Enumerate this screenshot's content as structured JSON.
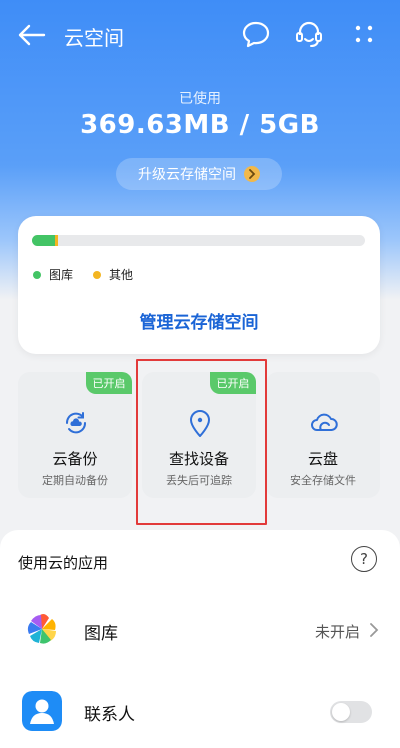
{
  "header": {
    "title": "云空间",
    "back_icon": "back-arrow-icon",
    "message_icon": "message-bubble-icon",
    "support_icon": "customer-service-icon",
    "more_icon": "more-dots-icon"
  },
  "usage": {
    "label": "已使用",
    "value": "369.63MB / 5GB",
    "upgrade_label": "升级云存储空间"
  },
  "storage": {
    "gallery_fraction": 0.07,
    "other_fraction": 0.008,
    "legend": [
      {
        "label": "图库",
        "color": "#43c465"
      },
      {
        "label": "其他",
        "color": "#f3b521"
      }
    ],
    "manage_label": "管理云存储空间"
  },
  "features": [
    {
      "name": "云备份",
      "subtitle": "定期自动备份",
      "badge": "已开启",
      "icon": "cloud-backup-icon"
    },
    {
      "name": "查找设备",
      "subtitle": "丢失后可追踪",
      "badge": "已开启",
      "icon": "location-pin-icon"
    },
    {
      "name": "云盘",
      "subtitle": "安全存储文件",
      "badge": "",
      "icon": "cloud-drive-icon"
    }
  ],
  "apps": {
    "title": "使用云的应用",
    "help_label": "?",
    "items": [
      {
        "name": "图库",
        "status": "未开启",
        "icon": "gallery-pinwheel-icon"
      },
      {
        "name": "联系人",
        "status": "",
        "icon": "contacts-icon",
        "toggle_on": false
      }
    ]
  },
  "colors": {
    "accent": "#1a64d6",
    "brand_blue": "#3f8df7",
    "badge_green": "#5ac96a",
    "highlight_red": "#e23a3a"
  }
}
